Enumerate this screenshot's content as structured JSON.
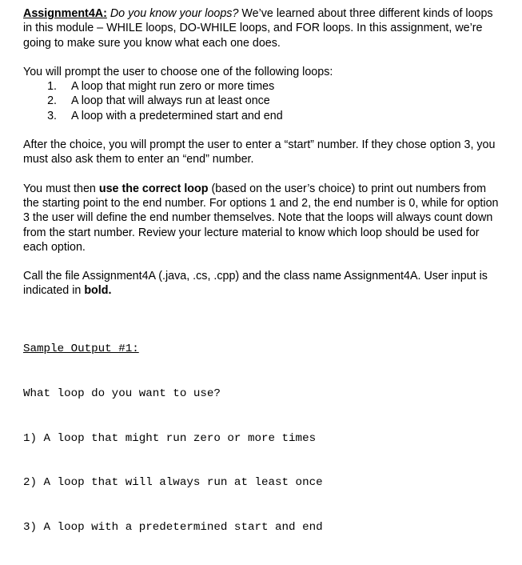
{
  "document": {
    "title_label": "Assignment4A:",
    "subtitle_italic": "Do you know your loops?",
    "intro_rest": " We’ve learned about three different kinds of loops in this module – WHILE loops, DO-WHILE loops, and FOR loops. In this assignment, we’re going to make sure you know what each one does.",
    "prompt_intro": "You will prompt the user to choose one of the following loops:",
    "loop_options": [
      "A loop that might run zero or more times",
      "A loop that will always run at least once",
      "A loop with a predetermined start and end"
    ],
    "after_choice_paragraph": "After the choice, you will prompt the user to enter a “start” number. If they chose option 3, you must also ask them to enter an “end” number.",
    "correct_loop_paragraph": {
      "lead": "You must then ",
      "bold_phrase": "use the correct loop",
      "rest": " (based on the user’s choice) to print out numbers from the starting point to the end number. For options 1 and 2, the end number is 0, while for option 3 the user will define the end number themselves. Note that the loops will always count down from the start number. Review your lecture material to know which loop should be used for each option."
    },
    "call_file_paragraph": {
      "lead": "Call the file Assignment4A (.java, .cs, .cpp) and the class name Assignment4A. User input is indicated in ",
      "bold_phrase": "bold."
    },
    "sample_output": {
      "heading": "Sample Output #1:",
      "lines": [
        "What loop do you want to use?",
        "1) A loop that might run zero or more times",
        "2) A loop that will always run at least once",
        "3) A loop with a predetermined start and end"
      ]
    }
  }
}
